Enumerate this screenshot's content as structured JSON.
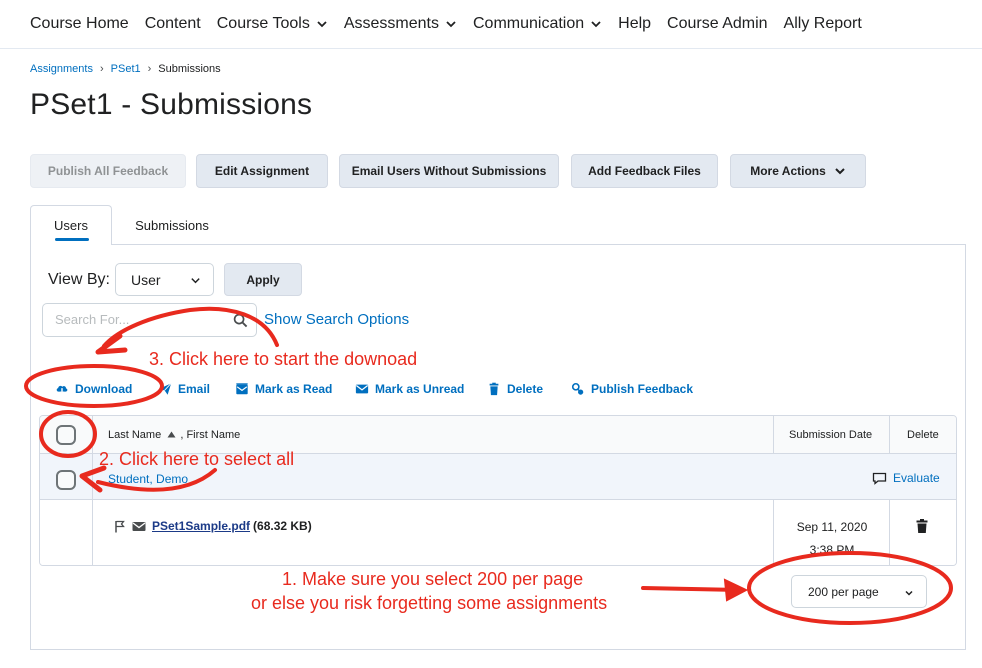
{
  "nav": {
    "items": [
      {
        "label": "Course Home",
        "dropdown": false
      },
      {
        "label": "Content",
        "dropdown": false
      },
      {
        "label": "Course Tools",
        "dropdown": true
      },
      {
        "label": "Assessments",
        "dropdown": true
      },
      {
        "label": "Communication",
        "dropdown": true
      },
      {
        "label": "Help",
        "dropdown": false
      },
      {
        "label": "Course Admin",
        "dropdown": false
      },
      {
        "label": "Ally Report",
        "dropdown": false
      }
    ]
  },
  "breadcrumb": {
    "items": [
      "Assignments",
      "PSet1"
    ],
    "current": "Submissions"
  },
  "page": {
    "title": "PSet1 - Submissions"
  },
  "actions": {
    "publish_all": "Publish All Feedback",
    "edit_assignment": "Edit Assignment",
    "email_users": "Email Users Without Submissions",
    "add_feedback": "Add Feedback Files",
    "more_actions": "More Actions"
  },
  "tabs": [
    "Users",
    "Submissions"
  ],
  "viewby": {
    "label": "View By:",
    "selected": "User",
    "apply": "Apply"
  },
  "search": {
    "placeholder": "Search For...",
    "options_link": "Show Search Options"
  },
  "toolbar": {
    "download": "Download",
    "email": "Email",
    "mark_read": "Mark as Read",
    "mark_unread": "Mark as Unread",
    "delete": "Delete",
    "publish_feedback": "Publish Feedback"
  },
  "grid": {
    "headers": {
      "name_last": "Last Name",
      "name_first": ", First Name",
      "submission_date": "Submission Date",
      "delete": "Delete"
    },
    "student": "Student, Demo",
    "evaluate": "Evaluate",
    "file": {
      "name": "PSet1Sample.pdf",
      "size": "(68.32 KB)",
      "date": "Sep 11, 2020",
      "time": "3:38 PM"
    }
  },
  "pagination": {
    "per_page": "200 per page"
  },
  "annotations": {
    "step1_line1": "1. Make sure you select 200 per page",
    "step1_line2": "or else you risk forgetting some assignments",
    "step2": "2. Click here to select all",
    "step3": "3. Click here to start the downoad",
    "color": "#e82a1e"
  },
  "colors": {
    "link": "#006fbf",
    "button_bg": "#e3e9f1",
    "border": "#d3d9e3",
    "annotation": "#e82a1e"
  }
}
